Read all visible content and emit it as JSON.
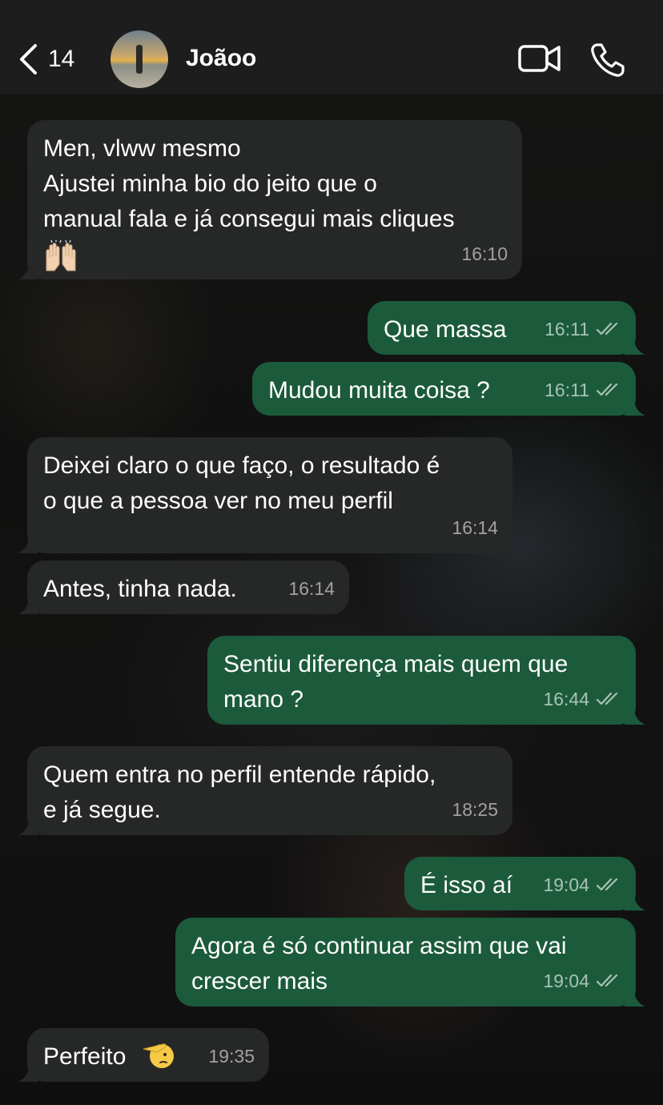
{
  "header": {
    "back_count": "14",
    "contact_name": "Joãoo"
  },
  "messages": [
    {
      "direction": "in",
      "text": "Men, vlww mesmo\nAjustei minha bio do jeito que o\nmanual fala e já consegui mais cliques",
      "emoji": "raised-hands-icon",
      "time": "16:10"
    },
    {
      "direction": "out",
      "text": "Que massa",
      "time": "16:11",
      "status": "read"
    },
    {
      "direction": "out",
      "text": "Mudou muita coisa ?",
      "time": "16:11",
      "status": "read"
    },
    {
      "direction": "in",
      "text": "Deixei claro o que faço, o resultado é\no que a pessoa ver no meu perfil",
      "time": "16:14"
    },
    {
      "direction": "in",
      "text": "Antes, tinha nada.",
      "time": "16:14"
    },
    {
      "direction": "out",
      "text": "Sentiu diferença mais quem que\nmano ?",
      "time": "16:44",
      "status": "read"
    },
    {
      "direction": "in",
      "text": "Quem entra no perfil entende rápido,\ne já segue.",
      "time": "18:25"
    },
    {
      "direction": "out",
      "text": "É isso aí",
      "time": "19:04",
      "status": "read"
    },
    {
      "direction": "out",
      "text": "Agora é só continuar assim que vai\ncrescer mais",
      "time": "19:04",
      "status": "read"
    },
    {
      "direction": "in",
      "text": "Perfeito",
      "emoji": "saluting-face-icon",
      "time": "19:35"
    }
  ],
  "colors": {
    "header_bg": "#1c1d1c",
    "incoming_bubble": "#262727",
    "outgoing_bubble": "#1c5a3c",
    "text": "#ffffff"
  }
}
